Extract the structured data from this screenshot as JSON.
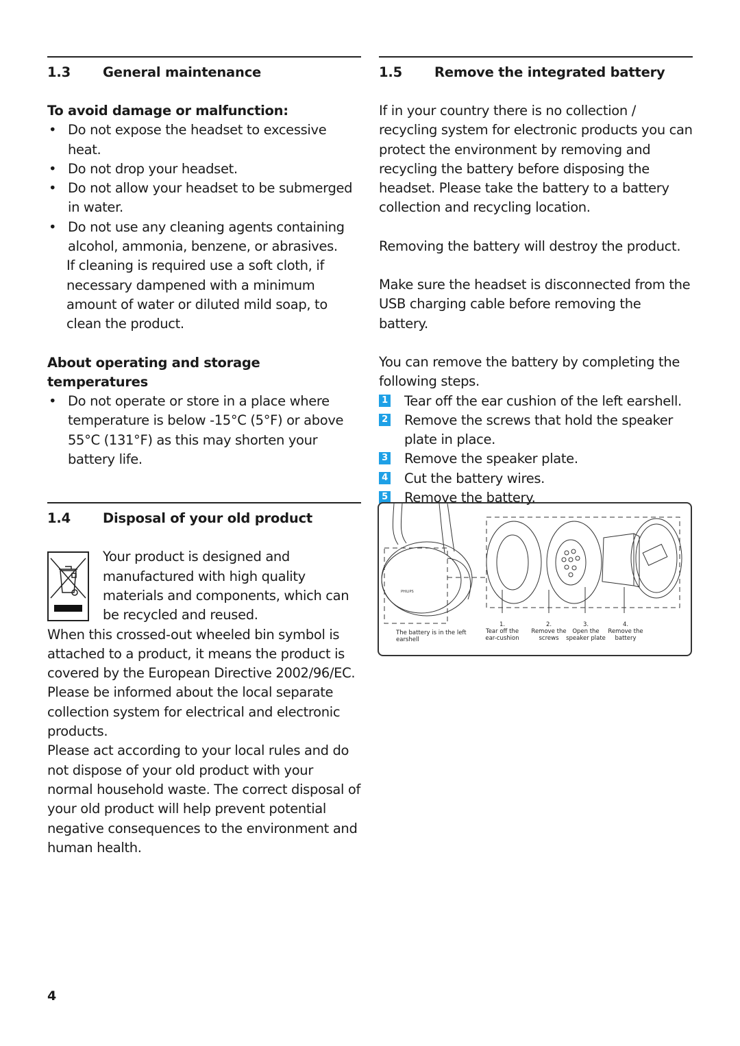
{
  "page_number": "4",
  "accent_color": "#1ea0e6",
  "section_1_3": {
    "number": "1.3",
    "title": "General maintenance",
    "subheading_damage": "To avoid damage or malfunction:",
    "bullets": [
      "Do not expose the headset to excessive heat.",
      "Do not drop your headset.",
      "Do not allow your headset to be submerged in water.",
      "Do not use any cleaning agents containing alcohol, ammonia, benzene, or abrasives."
    ],
    "cleaning_note": "If cleaning is required use a soft cloth, if necessary dampened with a minimum amount of water or diluted mild soap, to clean the product.",
    "subheading_temperature": "About operating and storage temperatures",
    "temperature_bullet": "Do not operate or store in a place where temperature is below -15°C (5°F) or above 55°C (131°F) as this may shorten your battery life."
  },
  "section_1_4": {
    "number": "1.4",
    "title": "Disposal of your old product",
    "icon": "crossed-out-wheeled-bin-icon",
    "intro": "Your product is designed and manufactured with high quality materials and components, which can be recycled and reused.",
    "paragraph_1": "When this crossed-out wheeled bin symbol is attached to a product, it means the product is covered by the European Directive 2002/96/EC. Please be informed about the local separate collection system for electrical and electronic products.",
    "paragraph_2": "Please act according to your local rules and do not dispose of your old product with your normal household waste. The correct disposal of your old product will help prevent potential negative consequences to the environment and human health."
  },
  "section_1_5": {
    "number": "1.5",
    "title": "Remove the integrated battery",
    "paragraph_1": "If in your country there is no collection / recycling system for electronic products you can protect the environment by removing and recycling the battery before disposing the headset. Please take the battery to a battery collection and recycling location.",
    "paragraph_2": "Removing the battery will destroy the product.",
    "paragraph_3": "Make sure the headset is disconnected from the USB charging cable before removing the battery.",
    "paragraph_4": "You can remove the battery by completing the following steps.",
    "steps": [
      {
        "n": "1",
        "text": "Tear off the ear cushion of the left earshell."
      },
      {
        "n": "2",
        "text": "Remove the screws that hold the speaker plate in place."
      },
      {
        "n": "3",
        "text": "Remove the speaker plate."
      },
      {
        "n": "4",
        "text": "Cut the battery wires."
      },
      {
        "n": "5",
        "text": "Remove the battery."
      }
    ],
    "figure": {
      "headset_brand": "PHILIPS",
      "caption_left": "The battery is in the left earshell",
      "labels": [
        {
          "n": "1.",
          "text": "Tear off the ear-cushion"
        },
        {
          "n": "2.",
          "text": "Remove the screws"
        },
        {
          "n": "3.",
          "text": "Open the speaker plate"
        },
        {
          "n": "4.",
          "text": "Remove the battery"
        }
      ]
    }
  }
}
